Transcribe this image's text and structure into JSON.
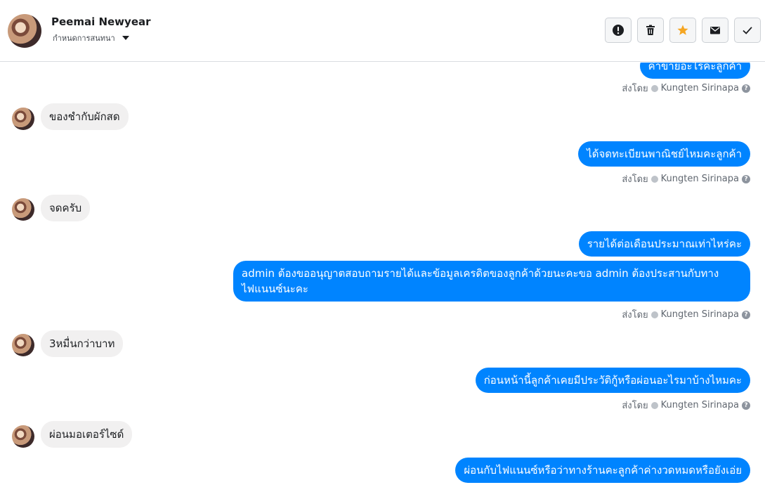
{
  "header": {
    "contact_name": "Peemai Newyear",
    "assign_label": "กำหนดการสนทนา",
    "icons": [
      "exclamation-icon",
      "trash-icon",
      "star-icon",
      "envelope-icon",
      "check-icon"
    ],
    "star_color": "#f5a623"
  },
  "messages": [
    {
      "dir": "out",
      "text": "ค่าขายอะไรคะลูกค้า"
    },
    {
      "dir": "in",
      "text": "ของชำกับผักสด"
    },
    {
      "dir": "out",
      "text": "ได้จดทะเบียนพาณิชย์ไหมคะลูกค้า"
    },
    {
      "dir": "in",
      "text": "จดครับ"
    },
    {
      "dir": "out",
      "text": "รายได้ต่อเดือนประมาณเท่าไหร่คะ"
    },
    {
      "dir": "out",
      "text": "admin ต้องขออนุญาตสอบถามรายได้และข้อมูลเครดิตของลูกค้าด้วยนะคะขอ admin ต้องประสานกับทาง ไฟแนนซ์นะคะ"
    },
    {
      "dir": "in",
      "text": "3หมื่นกว่าบาท"
    },
    {
      "dir": "out",
      "text": "ก่อนหน้านี้ลูกค้าเคยมีประวัติกู้หรือผ่อนอะไรมาบ้างไหมคะ"
    },
    {
      "dir": "in",
      "text": "ผ่อนมอเตอร์ไซด์"
    },
    {
      "dir": "out",
      "text": "ผ่อนกับไฟแนนซ์หรือว่าทางร้านคะลูกค้าค่างวดหมดหรือยังเอ่ย"
    }
  ],
  "sent_by": {
    "prefix": "ส่งโดย",
    "agent": "Kungten Sirinapa"
  },
  "colors": {
    "outgoing": "#0084ff",
    "incoming": "#f1f0f0"
  }
}
